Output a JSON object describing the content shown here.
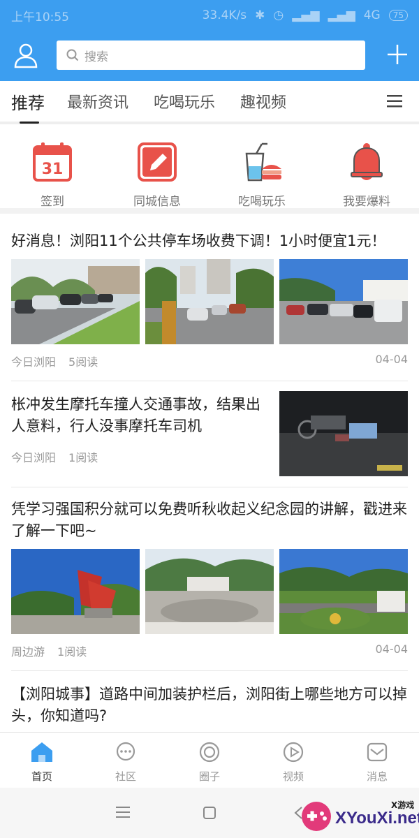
{
  "status_bar": {
    "time": "上午10:55",
    "network_speed": "33.4K/s",
    "network_type": "4G",
    "battery": "75"
  },
  "header": {
    "search_placeholder": "搜索"
  },
  "tabs": [
    "推荐",
    "最新资讯",
    "吃喝玩乐",
    "趣视频"
  ],
  "quick_actions": [
    {
      "label": "签到",
      "icon": "calendar-icon",
      "calendar_day": "31"
    },
    {
      "label": "同城信息",
      "icon": "edit-icon"
    },
    {
      "label": "吃喝玩乐",
      "icon": "drink-burger-icon"
    },
    {
      "label": "我要爆料",
      "icon": "bell-icon"
    }
  ],
  "articles": [
    {
      "title": "好消息！浏阳11个公共停车场收费下调！1小时便宜1元！",
      "source": "今日浏阳",
      "reads": "5阅读",
      "date": "04-04",
      "layout": "three-images"
    },
    {
      "title": "枨冲发生摩托车撞人交通事故，结果出人意料，行人没事摩托车司机",
      "source": "今日浏阳",
      "reads": "1阅读",
      "layout": "single-image"
    },
    {
      "title": "凭学习强国积分就可以免费听秋收起义纪念园的讲解，戳进来了解一下吧~",
      "source": "周边游",
      "reads": "1阅读",
      "date": "04-04",
      "layout": "three-images"
    },
    {
      "title": "【浏阳城事】道路中间加装护栏后，浏阳街上哪些地方可以掉头，你知道吗?",
      "layout": "partial"
    }
  ],
  "bottom_nav": [
    {
      "label": "首页",
      "icon": "home-icon",
      "active": true
    },
    {
      "label": "社区",
      "icon": "chat-icon",
      "active": false
    },
    {
      "label": "圈子",
      "icon": "circle-icon",
      "active": false
    },
    {
      "label": "视频",
      "icon": "play-icon",
      "active": false
    },
    {
      "label": "消息",
      "icon": "mail-icon",
      "active": false
    }
  ],
  "watermark": {
    "brand": "X游戏",
    "site": "XYouXi.net"
  },
  "colors": {
    "primary": "#3c9ef0",
    "icon_red": "#e8524a"
  }
}
